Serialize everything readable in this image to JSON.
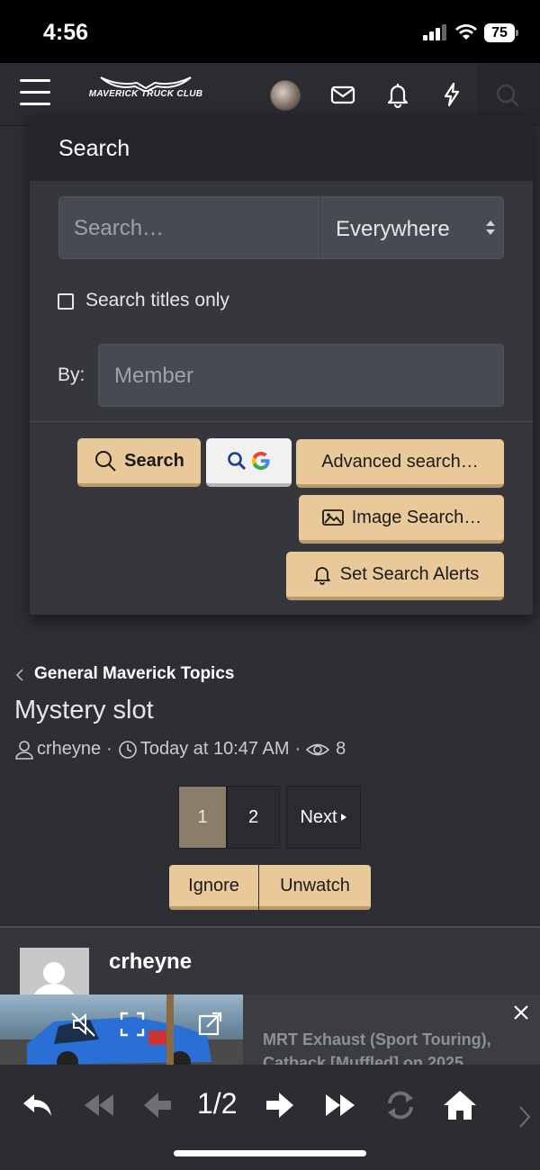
{
  "status_bar": {
    "time": "4:56",
    "battery": "75"
  },
  "header": {
    "logo_text": "MAVERICK TRUCK CLUB"
  },
  "search_menu": {
    "title": "Search",
    "search_placeholder": "Search…",
    "scope": "Everywhere",
    "titles_only_label": "Search titles only",
    "by_label": "By:",
    "member_placeholder": "Member",
    "search_button": "Search",
    "advanced_button": "Advanced search…",
    "image_button": "Image Search…",
    "alerts_button": "Set Search Alerts"
  },
  "thread": {
    "breadcrumb": "General Maverick Topics",
    "title": "Mystery slot",
    "author": "crheyne",
    "time": "Today at 10:47 AM",
    "views": "8"
  },
  "pagination": {
    "page1": "1",
    "page2": "2",
    "next": "Next"
  },
  "actions": {
    "ignore": "Ignore",
    "unwatch": "Unwatch"
  },
  "post": {
    "author": "crheyne"
  },
  "ad": {
    "text": "MRT Exhaust (Sport Touring), Catback [Muffled] on 2025"
  },
  "bottom_bar": {
    "page_count": "1/2"
  },
  "colors": {
    "button_accent": "#e9c99a",
    "background": "#2d2f34",
    "active_page": "#8a7e6a"
  }
}
